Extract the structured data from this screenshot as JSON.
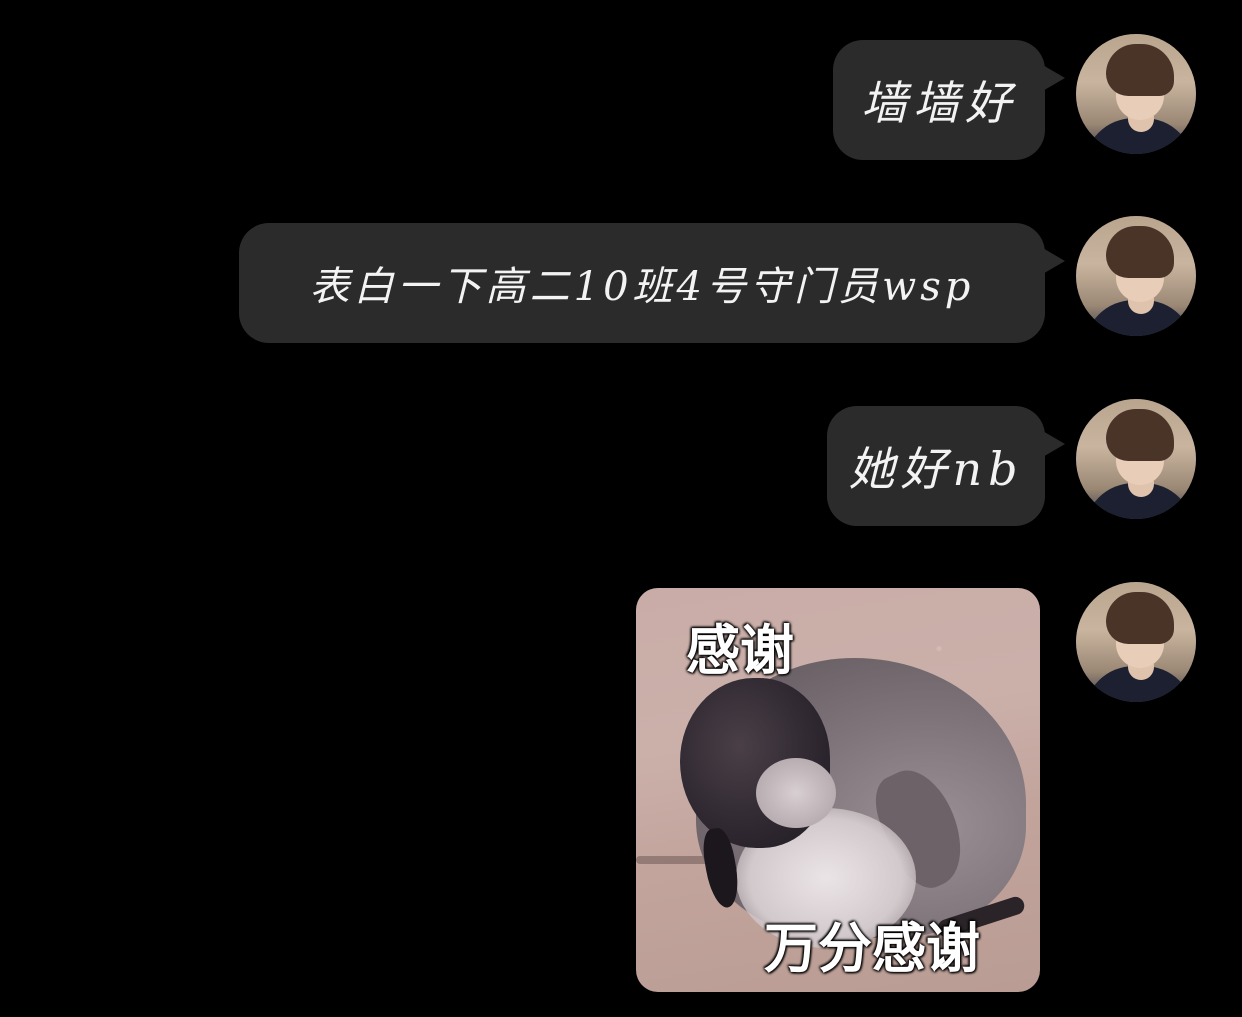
{
  "messages": [
    {
      "type": "text",
      "text": "墙墙好"
    },
    {
      "type": "text",
      "text": "表白一下高二10班4号守门员wsp"
    },
    {
      "type": "text",
      "text": "她好nb"
    },
    {
      "type": "sticker",
      "top_caption": "感谢",
      "bottom_caption": "万分感谢",
      "subject": "penguin-chick"
    }
  ],
  "colors": {
    "background": "#000000",
    "bubble": "#2b2b2b",
    "bubble_text": "#f3f3f3"
  }
}
